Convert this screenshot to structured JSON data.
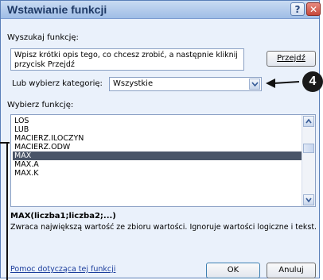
{
  "dialog": {
    "title": "Wstawianie funkcji",
    "help_glyph": "?",
    "close_glyph": "✕"
  },
  "search": {
    "label": "Wyszukaj funkcję:",
    "value": "Wpisz krótki opis tego, co chcesz zrobić, a następnie kliknij przycisk Przejdź",
    "go_button": "Przejdź"
  },
  "category": {
    "label": "Lub wybierz kategorię:",
    "selected": "Wszystkie"
  },
  "functions": {
    "label": "Wybierz funkcję:",
    "items": [
      "LOS",
      "LUB",
      "MACIERZ.ILOCZYN",
      "MACIERZ.ODW",
      "MAX",
      "MAX.A",
      "MAX.K"
    ],
    "selected": "MAX"
  },
  "details": {
    "signature": "MAX(liczba1;liczba2;...)",
    "description": "Zwraca największą wartość ze zbioru wartości. Ignoruje wartości logiczne i tekst."
  },
  "footer": {
    "help_link": "Pomoc dotycząca tej funkcji",
    "ok": "OK",
    "cancel": "Anuluj"
  },
  "annotation": {
    "step_number": "4"
  }
}
